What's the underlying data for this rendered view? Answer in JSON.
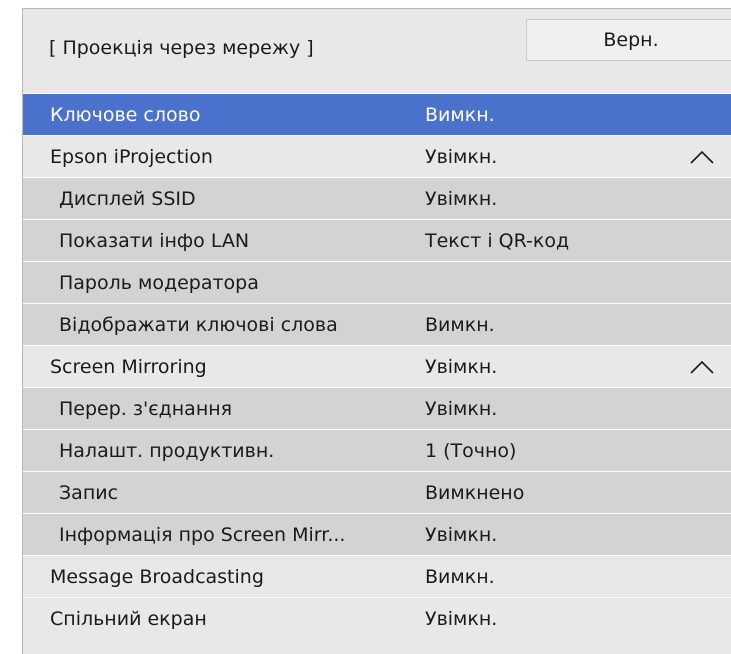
{
  "header": {
    "title": "[ Проекція через мережу ]",
    "back_label": "Верн."
  },
  "colors": {
    "selected": "#4a72cc",
    "top_row": "#e8e8e8",
    "sub_row": "#d3d3d3"
  },
  "rows": [
    {
      "label": "Ключове слово",
      "value": "Вимкн.",
      "level": "top",
      "selected": true
    },
    {
      "label": "Epson iProjection",
      "value": "Увімкн.",
      "level": "top",
      "expanded": true,
      "icon": "chevron-up-icon"
    },
    {
      "label": "Дисплей SSID",
      "value": "Увімкн.",
      "level": "sub"
    },
    {
      "label": "Показати інфо LAN",
      "value": "Текст і QR-код",
      "level": "sub"
    },
    {
      "label": "Пароль модератора",
      "value": "",
      "level": "sub"
    },
    {
      "label": "Відображати ключові слова",
      "value": "Вимкн.",
      "level": "sub"
    },
    {
      "label": "Screen Mirroring",
      "value": "Увімкн.",
      "level": "top",
      "expanded": true,
      "icon": "chevron-up-icon"
    },
    {
      "label": "Перер. з'єднання",
      "value": "Увімкн.",
      "level": "sub"
    },
    {
      "label": "Налашт. продуктивн.",
      "value": "1 (Точно)",
      "level": "sub"
    },
    {
      "label": "Запис",
      "value": "Вимкнено",
      "level": "sub"
    },
    {
      "label": "Інформація про Screen Mirr...",
      "value": "Увімкн.",
      "level": "sub"
    },
    {
      "label": "Message Broadcasting",
      "value": "Вимкн.",
      "level": "top"
    },
    {
      "label": "Спільний екран",
      "value": "Увімкн.",
      "level": "top"
    }
  ]
}
